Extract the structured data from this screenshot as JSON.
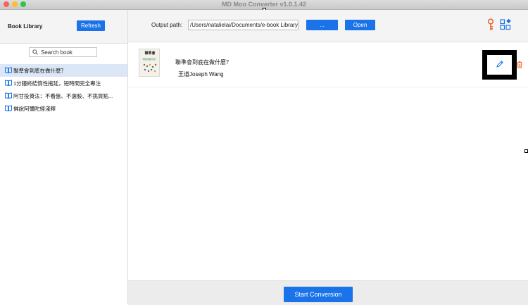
{
  "window": {
    "title": "MD Moo Converter v1.0.1.42"
  },
  "sidebar": {
    "title": "Book Library",
    "refresh_label": "Refresh",
    "search_placeholder": "Search book",
    "books": [
      {
        "title": "聯準會到底在做什麼？",
        "selected": true
      },
      {
        "title": "1分鐘終結惰性拖延，短時間完全專注",
        "selected": false
      },
      {
        "title": "阿甘投資法：不看盤、不選股、不挑買點...",
        "selected": false
      },
      {
        "title": "佛說阿彌陀經淺釋",
        "selected": false
      }
    ]
  },
  "toolbar": {
    "output_label": "Output path:",
    "output_path": "/Users/natalielai/Documents/e-book Library",
    "browse_label": "...",
    "open_label": "Open",
    "icons": [
      "key-icon",
      "apps-icon"
    ]
  },
  "book_detail": {
    "title": "聯準會到底在做什麼？",
    "author": "王道Joseph Wang",
    "cover_title": "聯準會",
    "cover_subtitle": "到底在做什麼？"
  },
  "footer": {
    "start_label": "Start Conversion"
  },
  "colors": {
    "accent": "#1a73e8",
    "selected_row": "#dbe6f7",
    "delete": "#e8632b",
    "key": "#e8632b"
  }
}
